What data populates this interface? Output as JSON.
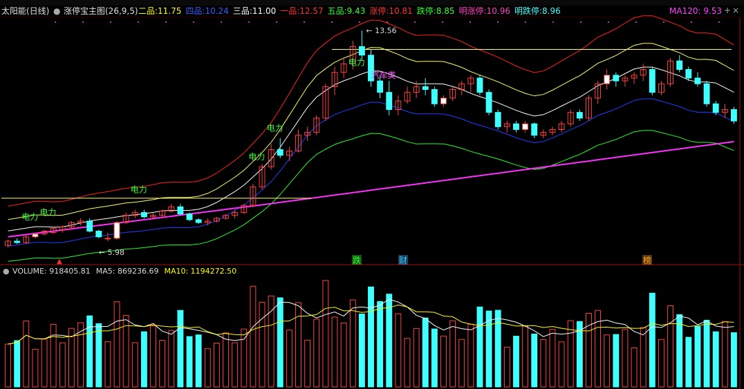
{
  "header": {
    "stock_name": "太阳能(日线)",
    "indicator_name": "涨停宝主图(26,9,5)",
    "items": [
      {
        "label": "二品:",
        "value": "11.75",
        "color": "#ffff00"
      },
      {
        "label": "四品:",
        "value": "10.24",
        "color": "#3060ff"
      },
      {
        "label": "三品:",
        "value": "11.00",
        "color": "#ffffff"
      },
      {
        "label": "一品:",
        "value": "12.57",
        "color": "#ff3030"
      },
      {
        "label": "五品:",
        "value": "9.43",
        "color": "#30ff30"
      },
      {
        "label": "涨停:",
        "value": "10.81",
        "color": "#ff3030"
      },
      {
        "label": "跌停:",
        "value": "8.85",
        "color": "#30ff30"
      },
      {
        "label": "明涨停:",
        "value": "10.96",
        "color": "#ff40c0"
      },
      {
        "label": "明跌停:",
        "value": "8.96",
        "color": "#40ffff"
      }
    ],
    "ma120": {
      "label": "MA120:",
      "value": "9.53",
      "color": "#ff40ff"
    }
  },
  "volume_header": {
    "volume": {
      "label": "VOLUME:",
      "value": "918405.81",
      "color": "#dddddd"
    },
    "ma5": {
      "label": "MA5:",
      "value": "869236.69",
      "color": "#dddddd"
    },
    "ma10": {
      "label": "MA10:",
      "value": "1194272.50",
      "color": "#ffff00"
    }
  },
  "annotations": {
    "high_label": "13.56",
    "low_label": "5.98",
    "power_label": "电力",
    "auto_label": "汽车类",
    "event_markers": [
      "跌",
      "财",
      "榜"
    ]
  },
  "colors": {
    "up_candle": "#ff4040",
    "down_candle": "#40ffff",
    "band_red": "#ff2020",
    "band_yellow": "#ffff60",
    "band_white": "#ffffff",
    "band_blue": "#2040ff",
    "band_green": "#20ff20",
    "ma120": "#ff30ff",
    "volume_ma5": "#ffffff",
    "volume_ma10": "#ffff00"
  },
  "chart_data": [
    {
      "type": "candlestick",
      "title": "太阳能(日线)",
      "ylim": [
        5.5,
        14.0
      ],
      "key_levels": {
        "high": 13.56,
        "low": 5.98,
        "horizontal_lines": [
          7.7,
          12.9
        ]
      },
      "candles_approx": [
        [
          6.05,
          6.25,
          5.98,
          6.2
        ],
        [
          6.2,
          6.3,
          6.1,
          6.15
        ],
        [
          6.15,
          6.4,
          6.1,
          6.35
        ],
        [
          6.35,
          6.5,
          6.3,
          6.45
        ],
        [
          6.45,
          6.6,
          6.4,
          6.55
        ],
        [
          6.5,
          6.7,
          6.45,
          6.65
        ],
        [
          6.6,
          6.75,
          6.5,
          6.7
        ],
        [
          6.7,
          6.9,
          6.6,
          6.85
        ],
        [
          6.85,
          7.0,
          6.75,
          6.9
        ],
        [
          6.9,
          7.0,
          6.5,
          6.55
        ],
        [
          6.55,
          6.6,
          6.3,
          6.35
        ],
        [
          6.3,
          6.5,
          6.2,
          6.3
        ],
        [
          6.3,
          6.9,
          6.25,
          6.85
        ],
        [
          6.85,
          7.2,
          6.8,
          7.1
        ],
        [
          7.1,
          7.3,
          7.0,
          7.2
        ],
        [
          7.2,
          7.3,
          7.0,
          7.05
        ],
        [
          7.05,
          7.2,
          6.95,
          7.1
        ],
        [
          7.1,
          7.3,
          7.0,
          7.25
        ],
        [
          7.25,
          7.5,
          7.2,
          7.4
        ],
        [
          7.4,
          7.5,
          7.1,
          7.15
        ],
        [
          7.15,
          7.2,
          6.9,
          6.95
        ],
        [
          6.95,
          7.0,
          6.8,
          6.85
        ],
        [
          6.85,
          7.0,
          6.75,
          6.9
        ],
        [
          6.9,
          7.05,
          6.85,
          7.0
        ],
        [
          7.0,
          7.15,
          6.95,
          7.1
        ],
        [
          7.1,
          7.3,
          7.0,
          7.2
        ],
        [
          7.2,
          7.5,
          7.15,
          7.45
        ],
        [
          7.45,
          8.2,
          7.4,
          8.1
        ],
        [
          8.1,
          8.9,
          8.0,
          8.8
        ],
        [
          8.8,
          9.6,
          8.7,
          9.4
        ],
        [
          9.4,
          9.8,
          9.1,
          9.2
        ],
        [
          9.2,
          9.5,
          9.0,
          9.35
        ],
        [
          9.35,
          10.1,
          9.3,
          9.9
        ],
        [
          9.9,
          10.2,
          9.7,
          10.0
        ],
        [
          10.0,
          10.6,
          9.9,
          10.5
        ],
        [
          10.5,
          11.7,
          10.4,
          11.6
        ],
        [
          11.6,
          12.3,
          11.3,
          12.1
        ],
        [
          12.1,
          12.6,
          11.9,
          12.4
        ],
        [
          12.4,
          13.2,
          12.2,
          13.0
        ],
        [
          13.0,
          13.56,
          12.5,
          12.7
        ],
        [
          12.7,
          12.9,
          11.6,
          11.8
        ],
        [
          11.8,
          12.0,
          11.2,
          11.4
        ],
        [
          11.4,
          11.8,
          10.6,
          10.8
        ],
        [
          10.8,
          11.3,
          10.6,
          11.1
        ],
        [
          11.1,
          11.6,
          11.0,
          11.4
        ],
        [
          11.4,
          11.8,
          11.2,
          11.6
        ],
        [
          11.6,
          11.9,
          11.3,
          11.5
        ],
        [
          11.5,
          11.6,
          10.9,
          11.0
        ],
        [
          11.0,
          11.3,
          10.9,
          11.2
        ],
        [
          11.2,
          11.6,
          11.1,
          11.5
        ],
        [
          11.5,
          11.8,
          11.3,
          11.7
        ],
        [
          11.7,
          12.0,
          11.4,
          11.9
        ],
        [
          11.9,
          12.0,
          11.3,
          11.4
        ],
        [
          11.4,
          11.5,
          10.6,
          10.7
        ],
        [
          10.7,
          10.8,
          10.1,
          10.2
        ],
        [
          10.2,
          10.4,
          10.0,
          10.3
        ],
        [
          10.3,
          10.4,
          10.0,
          10.1
        ],
        [
          10.1,
          10.4,
          10.0,
          10.3
        ],
        [
          10.3,
          10.35,
          9.8,
          9.9
        ],
        [
          9.9,
          10.1,
          9.8,
          10.0
        ],
        [
          10.0,
          10.2,
          9.9,
          10.1
        ],
        [
          10.1,
          10.4,
          10.0,
          10.3
        ],
        [
          10.3,
          10.8,
          10.2,
          10.7
        ],
        [
          10.7,
          10.8,
          10.4,
          10.5
        ],
        [
          10.5,
          11.3,
          10.4,
          11.2
        ],
        [
          11.2,
          11.8,
          11.0,
          11.7
        ],
        [
          11.7,
          12.2,
          11.5,
          12.0
        ],
        [
          12.0,
          12.1,
          11.6,
          11.8
        ],
        [
          11.8,
          12.0,
          11.6,
          11.9
        ],
        [
          11.9,
          12.1,
          11.7,
          12.0
        ],
        [
          12.0,
          12.4,
          11.8,
          12.2
        ],
        [
          12.2,
          12.3,
          11.3,
          11.4
        ],
        [
          11.4,
          11.8,
          11.3,
          11.7
        ],
        [
          11.7,
          12.6,
          11.6,
          12.5
        ],
        [
          12.5,
          12.7,
          12.1,
          12.2
        ],
        [
          12.2,
          12.3,
          11.8,
          11.9
        ],
        [
          11.9,
          12.1,
          11.6,
          11.7
        ],
        [
          11.7,
          11.8,
          10.9,
          11.0
        ],
        [
          11.0,
          11.1,
          10.6,
          10.7
        ],
        [
          10.7,
          11.0,
          10.5,
          10.8
        ],
        [
          10.8,
          10.9,
          10.3,
          10.4
        ]
      ]
    },
    {
      "type": "bar",
      "title": "VOLUME",
      "series": [
        {
          "name": "VOLUME",
          "latest": 918405.81
        },
        {
          "name": "MA5",
          "latest": 869236.69
        },
        {
          "name": "MA10",
          "latest": 1194272.5
        }
      ]
    }
  ]
}
